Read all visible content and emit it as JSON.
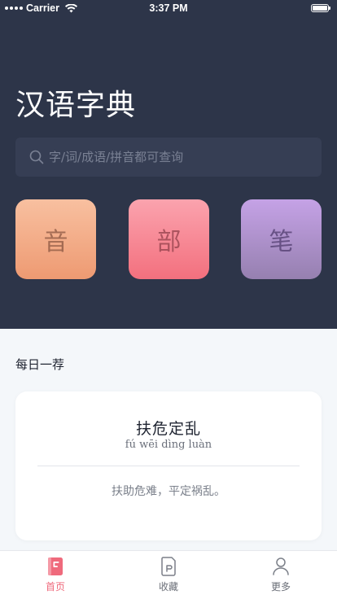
{
  "status_bar": {
    "carrier": "Carrier",
    "time": "3:37 PM"
  },
  "app": {
    "title": "汉语字典"
  },
  "search": {
    "placeholder": "字/词/成语/拼音都可查询"
  },
  "tiles": [
    {
      "label": "音"
    },
    {
      "label": "部"
    },
    {
      "label": "笔"
    }
  ],
  "daily": {
    "section_title": "每日一荐",
    "idiom": "扶危定乱",
    "pinyin": "fú wēi dìng luàn",
    "meaning": "扶助危难，平定祸乱。"
  },
  "tabs": [
    {
      "label": "首页",
      "icon": "home-book-icon",
      "active": true
    },
    {
      "label": "收藏",
      "icon": "favorites-doc-icon",
      "active": false
    },
    {
      "label": "更多",
      "icon": "person-icon",
      "active": false
    }
  ],
  "colors": {
    "hero_bg": "#2d3549",
    "accent": "#ef6a7c",
    "tile_sound": "#ee9a72",
    "tile_radical": "#f3707e",
    "tile_stroke": "#9680b0"
  }
}
